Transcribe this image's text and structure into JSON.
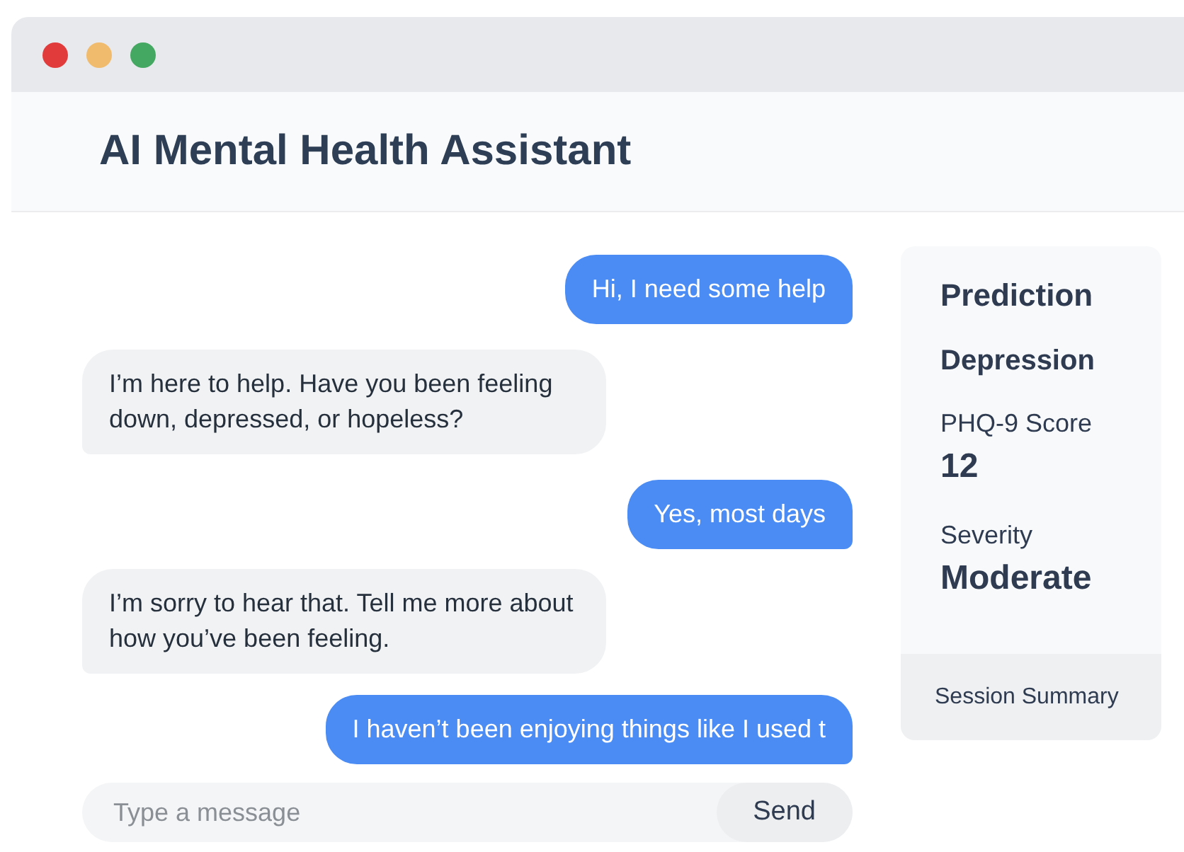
{
  "window": {
    "title": "AI Mental Health Assistant"
  },
  "messages": [
    {
      "kind": "user",
      "text": "Hi, I need some help"
    },
    {
      "kind": "bot",
      "text": "I’m here to help. Have you been feeling down, depressed, or hopeless?"
    },
    {
      "kind": "user",
      "text": "Yes, most days"
    },
    {
      "kind": "bot",
      "text": "I’m sorry to hear that. Tell me more about how you’ve been feeling."
    },
    {
      "kind": "user",
      "text": "I haven’t been enjoying things like I used t"
    }
  ],
  "composer": {
    "placeholder": "Type a message",
    "button": "Send"
  },
  "summary": {
    "items": [
      {
        "kind": "title",
        "text": "Prediction"
      },
      {
        "kind": "result",
        "text": "Depression"
      },
      {
        "kind": "label",
        "text": "PHQ-9 Score"
      },
      {
        "kind": "value",
        "text": "12"
      },
      {
        "kind": "label",
        "text": "Severity"
      },
      {
        "kind": "value",
        "text": "Moderate"
      }
    ],
    "footer": "Session Summary"
  }
}
